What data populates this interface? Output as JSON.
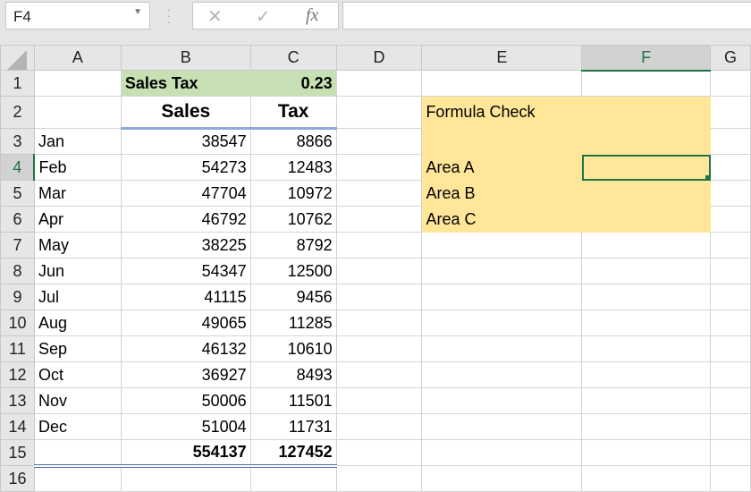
{
  "formula_bar": {
    "name_box": "F4",
    "cancel_icon": "✕",
    "enter_icon": "✓",
    "fx_label": "fx",
    "formula": ""
  },
  "selected_cell": "F4",
  "columns": [
    "A",
    "B",
    "C",
    "D",
    "E",
    "F",
    "G"
  ],
  "rows": [
    {
      "n": "1",
      "cells": [
        "",
        "Sales Tax",
        "0.23",
        "",
        "",
        "",
        ""
      ]
    },
    {
      "n": "2",
      "cells": [
        "",
        "Sales",
        "Tax",
        "",
        "Formula Check",
        "",
        ""
      ]
    },
    {
      "n": "3",
      "cells": [
        "Jan",
        "38547",
        "8866",
        "",
        "",
        "",
        ""
      ]
    },
    {
      "n": "4",
      "cells": [
        "Feb",
        "54273",
        "12483",
        "",
        "Area A",
        "",
        ""
      ]
    },
    {
      "n": "5",
      "cells": [
        "Mar",
        "47704",
        "10972",
        "",
        "Area B",
        "",
        ""
      ]
    },
    {
      "n": "6",
      "cells": [
        "Apr",
        "46792",
        "10762",
        "",
        "Area C",
        "",
        ""
      ]
    },
    {
      "n": "7",
      "cells": [
        "May",
        "38225",
        "8792",
        "",
        "",
        "",
        ""
      ]
    },
    {
      "n": "8",
      "cells": [
        "Jun",
        "54347",
        "12500",
        "",
        "",
        "",
        ""
      ]
    },
    {
      "n": "9",
      "cells": [
        "Jul",
        "41115",
        "9456",
        "",
        "",
        "",
        ""
      ]
    },
    {
      "n": "10",
      "cells": [
        "Aug",
        "49065",
        "11285",
        "",
        "",
        "",
        ""
      ]
    },
    {
      "n": "11",
      "cells": [
        "Sep",
        "46132",
        "10610",
        "",
        "",
        "",
        ""
      ]
    },
    {
      "n": "12",
      "cells": [
        "Oct",
        "36927",
        "8493",
        "",
        "",
        "",
        ""
      ]
    },
    {
      "n": "13",
      "cells": [
        "Nov",
        "50006",
        "11501",
        "",
        "",
        "",
        ""
      ]
    },
    {
      "n": "14",
      "cells": [
        "Dec",
        "51004",
        "11731",
        "",
        "",
        "",
        ""
      ]
    },
    {
      "n": "15",
      "cells": [
        "",
        "554137",
        "127452",
        "",
        "",
        "",
        ""
      ]
    },
    {
      "n": "16",
      "cells": [
        "",
        "",
        "",
        "",
        "",
        "",
        ""
      ]
    }
  ],
  "colors": {
    "green_fill": "#c6e0b4",
    "yellow_fill": "#ffe699",
    "yellow_text": "#9c5700",
    "header_text": "#44546a",
    "selection": "#217346"
  }
}
